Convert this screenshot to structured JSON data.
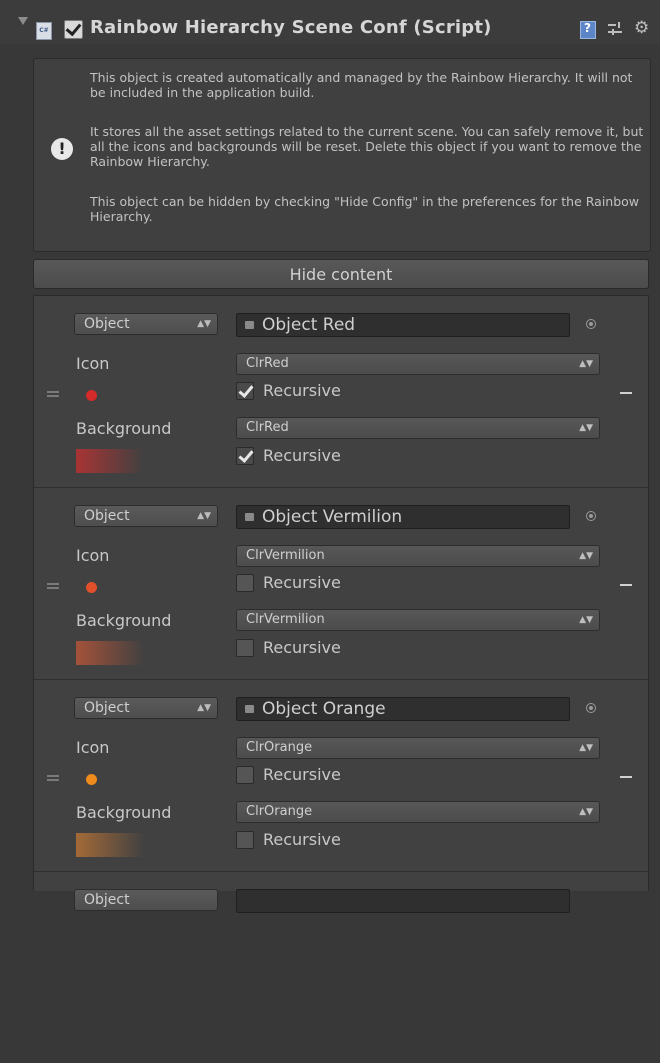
{
  "header": {
    "title": "Rainbow Hierarchy Scene Conf (Script)",
    "script_icon_text": "C#",
    "icons": [
      "chevron-down-icon",
      "script-icon",
      "checkbox-icon",
      "help-book-icon",
      "preset-icon",
      "gear-icon"
    ]
  },
  "help": {
    "p1": "This object is created automatically and managed by the Rainbow Hierarchy. It will not be included in the application build.",
    "p2": "It stores all the asset settings related to the current scene. You can safely remove it, but all the icons and backgrounds will be reset. Delete this object if you want to remove the Rainbow Hierarchy.",
    "p3": "This object can be hidden by checking \"Hide Config\" in the preferences for the Rainbow Hierarchy."
  },
  "hide_button": "Hide content",
  "labels": {
    "icon": "Icon",
    "background": "Background",
    "recursive": "Recursive"
  },
  "entries": [
    {
      "type": "Object",
      "name": "Object Red",
      "icon": "ClrRed",
      "icon_recursive": true,
      "background": "ClrRed",
      "background_recursive": true,
      "color": "#d42a2a",
      "bg_color": "#a83434"
    },
    {
      "type": "Object",
      "name": "Object Vermilion",
      "icon": "ClrVermilion",
      "icon_recursive": false,
      "background": "ClrVermilion",
      "background_recursive": false,
      "color": "#e0502a",
      "bg_color": "#a4523a"
    },
    {
      "type": "Object",
      "name": "Object Orange",
      "icon": "ClrOrange",
      "icon_recursive": false,
      "background": "ClrOrange",
      "background_recursive": false,
      "color": "#ef8a1c",
      "bg_color": "#a46a38"
    },
    {
      "type": "Object",
      "name": "",
      "icon": "",
      "icon_recursive": false,
      "background": "",
      "background_recursive": false,
      "color": "#414141",
      "bg_color": "#414141"
    }
  ]
}
